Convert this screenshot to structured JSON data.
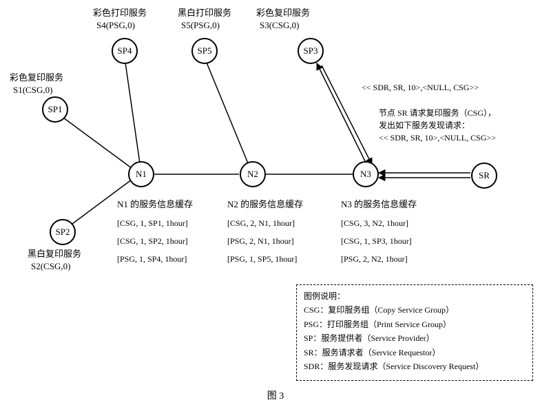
{
  "caption": "图 3",
  "nodes": {
    "SP1": "SP1",
    "SP2": "SP2",
    "SP3": "SP3",
    "SP4": "SP4",
    "SP5": "SP5",
    "N1": "N1",
    "N2": "N2",
    "N3": "N3",
    "SR": "SR"
  },
  "labels": {
    "sp4_t1": "彩色打印服务",
    "sp4_t2": "S4(PSG,0)",
    "sp5_t1": "黑白打印服务",
    "sp5_t2": "S5(PSG,0)",
    "sp3_t1": "彩色复印服务",
    "sp3_t2": "S3(CSG,0)",
    "sp1_t1": "彩色复印服务",
    "sp1_t2": "S1(CSG,0)",
    "sp2_t1": "黑白复印服务",
    "sp2_t2": "S2(CSG,0)"
  },
  "sr_note": {
    "l1": "节点 SR 请求复印服务（CSG），",
    "l2": "发出如下服务发现请求：",
    "l3": "<< SDR, SR, 10>,<NULL, CSG>>"
  },
  "edge_note": "<< SDR, SR, 10>,<NULL, CSG>>",
  "cache": {
    "n1": {
      "title": "N1 的服务信息缓存",
      "rows": [
        "[CSG, 1, SP1, 1hour]",
        "[CSG, 1, SP2, 1hour]",
        "[PSG, 1, SP4, 1hour]"
      ]
    },
    "n2": {
      "title": "N2 的服务信息缓存",
      "rows": [
        "[CSG, 2, N1, 1hour]",
        "[PSG, 2, N1, 1hour]",
        "[PSG, 1, SP5, 1hour]"
      ]
    },
    "n3": {
      "title": "N3 的服务信息缓存",
      "rows": [
        "[CSG, 3, N2, 1hour]",
        "[CSG, 1, SP3, 1hour]",
        "[PSG, 2, N2, 1hour]"
      ]
    }
  },
  "legend": {
    "title": "图例说明：",
    "rows": [
      "CSG：复印服务组（Copy Service Group）",
      "PSG：打印服务组（Print Service Group）",
      "SP：服务提供者（Service Provider）",
      "SR：服务请求者（Service Requestor）",
      "SDR：服务发现请求（Service Discovery Request）"
    ]
  }
}
